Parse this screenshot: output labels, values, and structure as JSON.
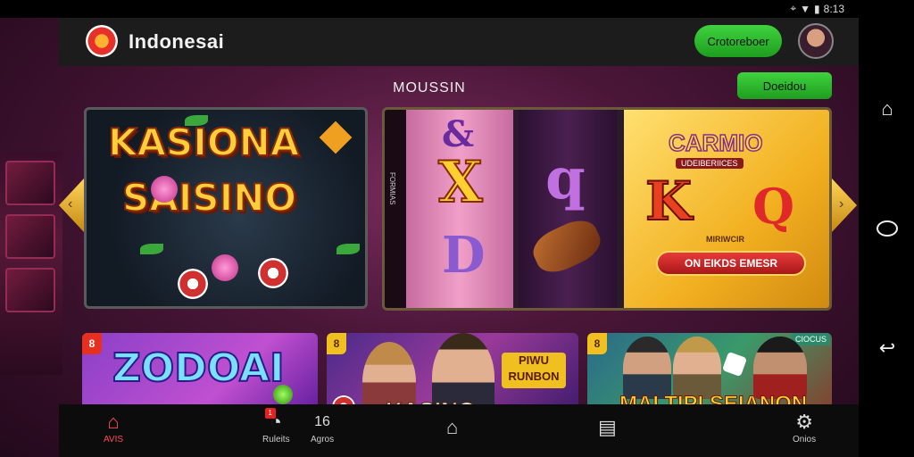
{
  "status": {
    "time": "8:13",
    "icons": [
      "location-icon",
      "wifi-icon",
      "signal-icon"
    ]
  },
  "header": {
    "brand": "Indonesai",
    "action_button": "Crotoreboer"
  },
  "section": {
    "title": "MOUSSIN",
    "action_button": "Doeidou"
  },
  "carousel": {
    "banner1": {
      "line1": "KASIONA",
      "line2": "SAISINO"
    },
    "banner2": {
      "brand": "CARMIO",
      "subtitle": "UDEIBERIICES",
      "letter_k": "K",
      "letter_q": "Q",
      "symbol_x": "X",
      "symbol_d": "D",
      "symbol_q": "q",
      "small_text": "MIRIWCIR",
      "cta": "ON EIKDS EMESR",
      "side_text": "FORMIAS"
    }
  },
  "cards": [
    {
      "tag": "8",
      "title": "ZODOAI"
    },
    {
      "tag": "8",
      "title": "KASINO",
      "sub": "PIWU RUNBON"
    },
    {
      "tag": "8",
      "title": "MALTIPI SEIANON",
      "corner": "CIOCUS"
    }
  ],
  "bottom_nav": {
    "items": [
      {
        "label": "AVIS",
        "icon": "home-icon",
        "active": true
      },
      {
        "label": "Ruleits",
        "icon": "timer-icon",
        "badge": "1"
      },
      {
        "label": "Agros",
        "count": "16"
      },
      {
        "label": "",
        "icon": "house-icon"
      },
      {
        "label": "",
        "icon": "list-icon"
      },
      {
        "label": "Onios",
        "icon": "gear-icon"
      }
    ]
  },
  "colors": {
    "accent_green": "#2ec02e",
    "active_nav": "#ff4a5a",
    "header_bg": "#1c1c1c"
  }
}
